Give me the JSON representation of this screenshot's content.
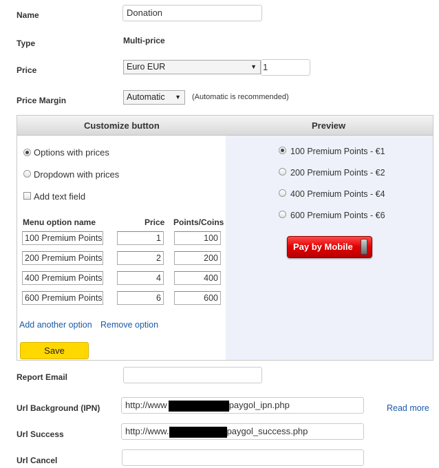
{
  "form": {
    "name_label": "Name",
    "name_value": "Donation",
    "type_label": "Type",
    "type_value": "Multi-price",
    "price_label": "Price",
    "price_currency": "Euro EUR",
    "price_value": "1",
    "margin_label": "Price Margin",
    "margin_value": "Automatic",
    "margin_hint": "(Automatic is recommended)"
  },
  "customize": {
    "header": "Customize button",
    "options": [
      {
        "label": "Options with prices",
        "selected": true
      },
      {
        "label": "Dropdown with prices",
        "selected": false
      }
    ],
    "add_text_field": "Add text field",
    "columns": {
      "name": "Menu option name",
      "price": "Price",
      "points": "Points/Coins"
    },
    "rows": [
      {
        "name": "100 Premium Points",
        "price": "1",
        "points": "100"
      },
      {
        "name": "200 Premium Points",
        "price": "2",
        "points": "200"
      },
      {
        "name": "400 Premium Points",
        "price": "4",
        "points": "400"
      },
      {
        "name": "600 Premium Points",
        "price": "6",
        "points": "600"
      }
    ],
    "add_option": "Add another option",
    "remove_option": "Remove option",
    "save": "Save"
  },
  "preview": {
    "header": "Preview",
    "items": [
      {
        "label": "100 Premium Points - €1",
        "selected": true
      },
      {
        "label": "200 Premium Points - €2",
        "selected": false
      },
      {
        "label": "400 Premium Points - €4",
        "selected": false
      },
      {
        "label": "600 Premium Points - €6",
        "selected": false
      }
    ],
    "pay_button": "Pay by Mobile"
  },
  "urls": {
    "report_email_label": "Report Email",
    "report_email_value": "",
    "ipn_label": "Url Background (IPN)",
    "ipn_prefix": "http://www",
    "ipn_suffix": "paygol_ipn.php",
    "read_more": "Read more",
    "success_label": "Url Success",
    "success_prefix": "http://www.",
    "success_suffix": "paygol_success.php",
    "cancel_label": "Url Cancel",
    "cancel_value": ""
  }
}
